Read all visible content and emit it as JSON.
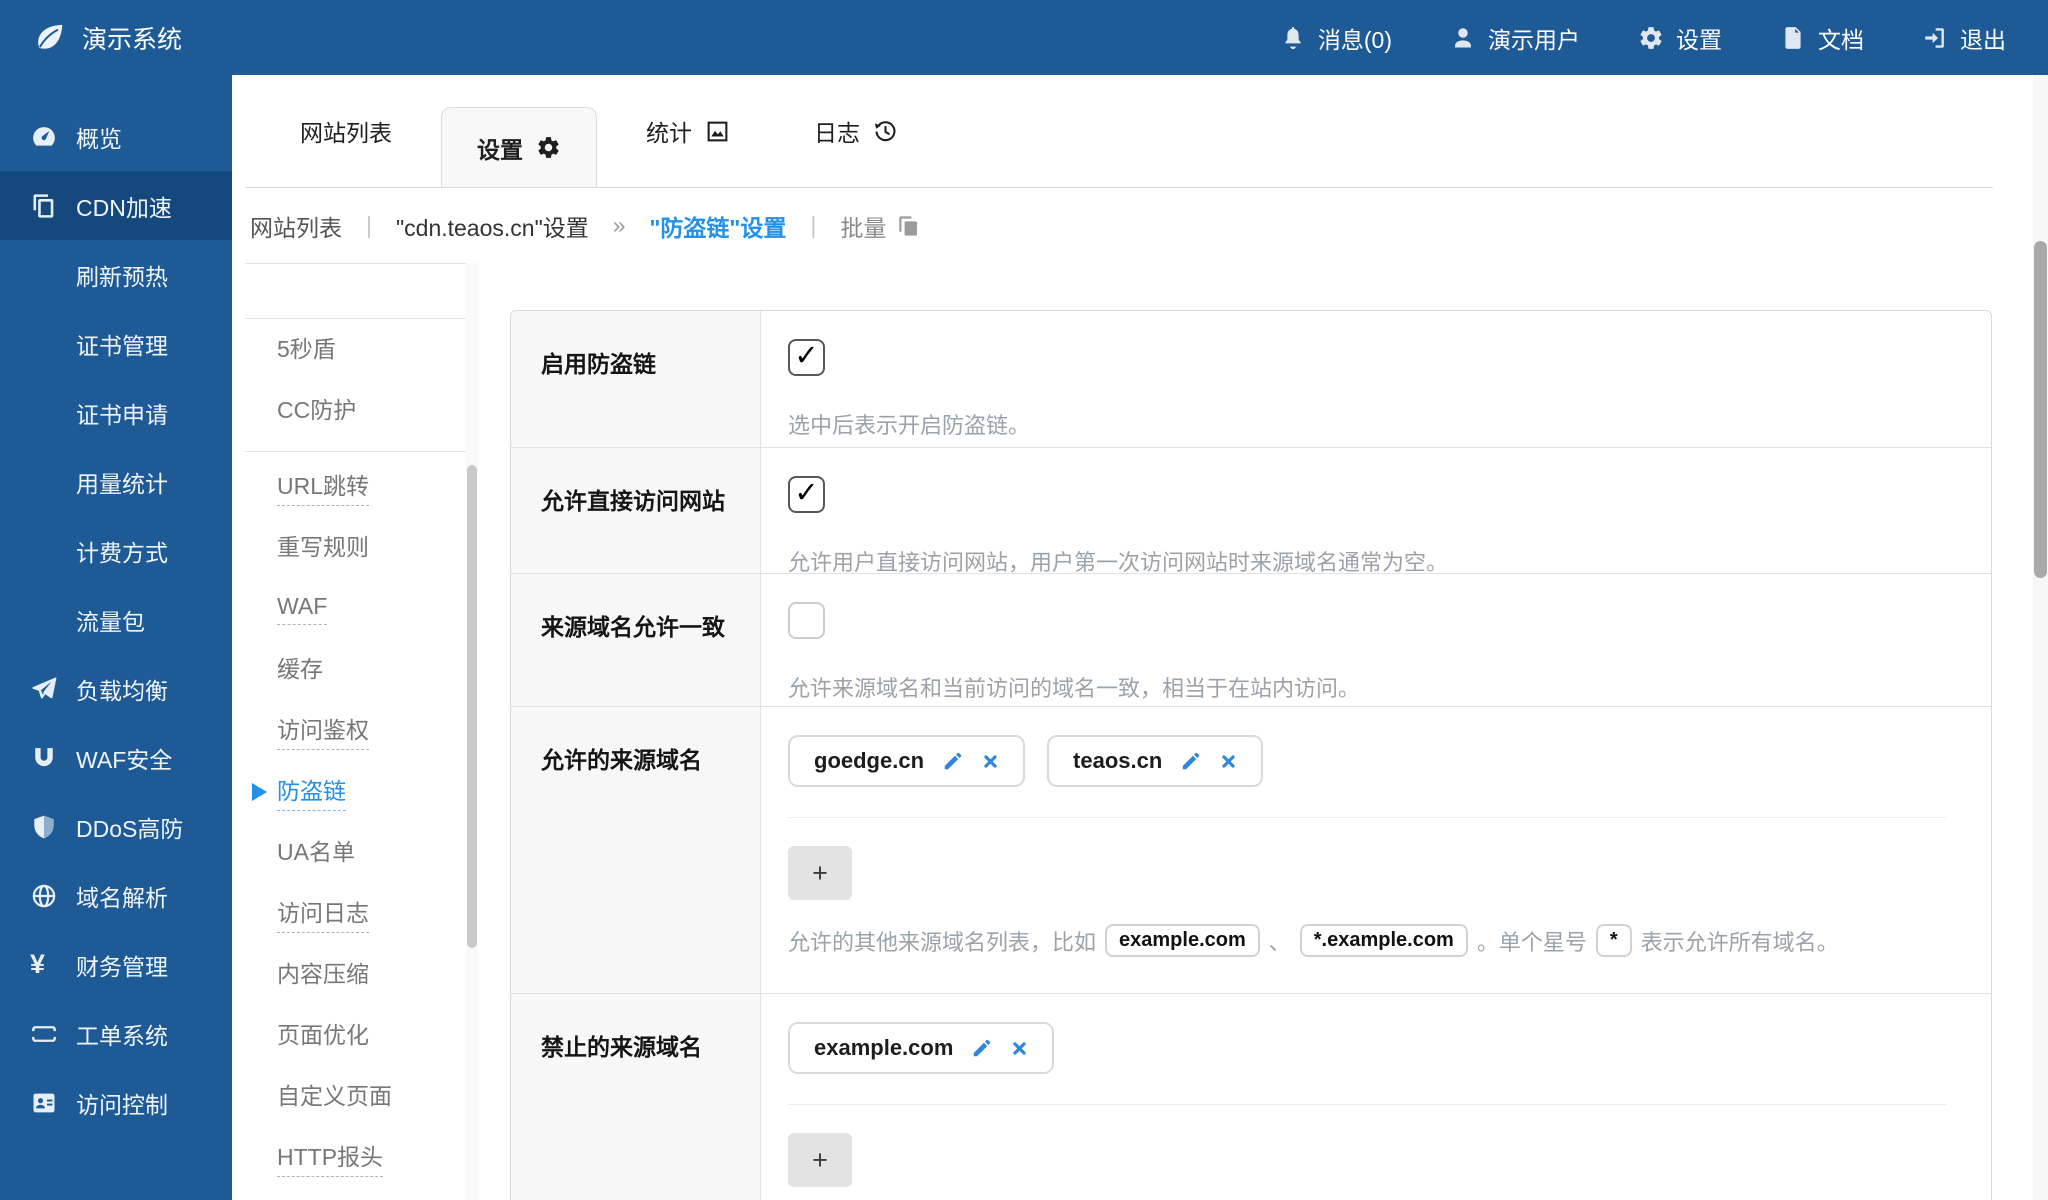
{
  "colors": {
    "brand_blue": "#1e5a96",
    "sidebar_active_bg": "#15497e",
    "link_blue": "#2490e8",
    "desc_gray": "#9aa3ab",
    "tag_icon_blue": "#2e86de"
  },
  "glyphs": {
    "check": "✓",
    "plus": "+",
    "yen": "¥",
    "pipe": "|",
    "arrow": "»"
  },
  "topbar": {
    "brand": "演示系统",
    "nav": [
      {
        "label": "消息(0)"
      },
      {
        "label": "演示用户"
      },
      {
        "label": "设置"
      },
      {
        "label": "文档"
      },
      {
        "label": "退出"
      }
    ]
  },
  "sidebar": {
    "items": [
      {
        "label": "概览"
      },
      {
        "label": "CDN加速"
      },
      {
        "label": "刷新预热"
      },
      {
        "label": "证书管理"
      },
      {
        "label": "证书申请"
      },
      {
        "label": "用量统计"
      },
      {
        "label": "计费方式"
      },
      {
        "label": "流量包"
      },
      {
        "label": "负载均衡"
      },
      {
        "label": "WAF安全"
      },
      {
        "label": "DDoS高防"
      },
      {
        "label": "域名解析"
      },
      {
        "label": "财务管理"
      },
      {
        "label": "工单系统"
      },
      {
        "label": "访问控制"
      }
    ]
  },
  "tabs": {
    "items": [
      {
        "label": "网站列表"
      },
      {
        "label": "设置"
      },
      {
        "label": "统计"
      },
      {
        "label": "日志"
      }
    ]
  },
  "breadcrumb": {
    "site_list": "网站列表",
    "site_settings": "\"cdn.teaos.cn\"设置",
    "current": "\"防盗链\"设置",
    "batch": "批量"
  },
  "settings_menu": {
    "group1": [
      {
        "label": "5秒盾"
      },
      {
        "label": "CC防护"
      }
    ],
    "group2": [
      {
        "label": "URL跳转"
      },
      {
        "label": "重写规则"
      },
      {
        "label": "WAF"
      },
      {
        "label": "缓存"
      },
      {
        "label": "访问鉴权"
      },
      {
        "label": "防盗链"
      },
      {
        "label": "UA名单"
      },
      {
        "label": "访问日志"
      },
      {
        "label": "内容压缩"
      },
      {
        "label": "页面优化"
      },
      {
        "label": "自定义页面"
      },
      {
        "label": "HTTP报头"
      }
    ]
  },
  "form": {
    "rows": [
      {
        "label": "启用防盗链",
        "checked": true,
        "desc": "选中后表示开启防盗链。"
      },
      {
        "label": "允许直接访问网站",
        "checked": true,
        "desc": "允许用户直接访问网站，用户第一次访问网站时来源域名通常为空。"
      },
      {
        "label": "来源域名允许一致",
        "checked": false,
        "desc": "允许来源域名和当前访问的域名一致，相当于在站内访问。"
      },
      {
        "label": "允许的来源域名",
        "tags": [
          {
            "text": "goedge.cn"
          },
          {
            "text": "teaos.cn"
          }
        ],
        "add": "+",
        "desc_prefix": "允许的其他来源域名列表，比如",
        "badge1": "example.com",
        "comma": "、",
        "badge2": "*.example.com",
        "desc_mid": "。单个星号",
        "badge3": "*",
        "desc_suffix": "表示允许所有域名。"
      },
      {
        "label": "禁止的来源域名",
        "tags": [
          {
            "text": "example.com"
          }
        ],
        "add": "+"
      }
    ]
  }
}
